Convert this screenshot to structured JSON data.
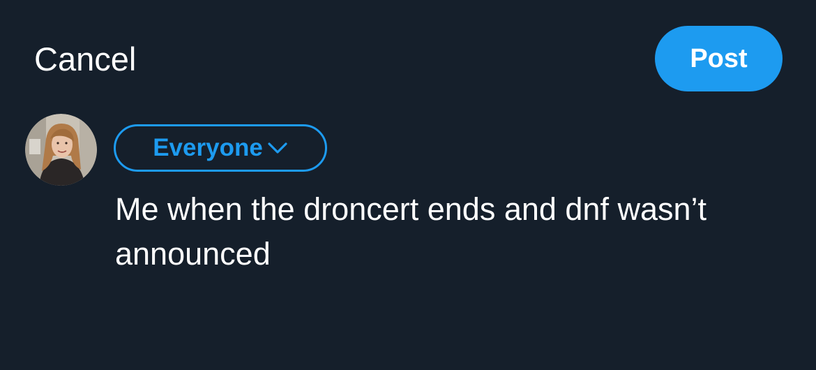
{
  "header": {
    "cancel_label": "Cancel",
    "post_label": "Post"
  },
  "composer": {
    "audience_label": "Everyone",
    "text": "Me when the droncert ends and dnf wasn’t announced"
  },
  "icons": {
    "audience_chevron": "chevron-down-icon",
    "avatar": "user-avatar"
  },
  "colors": {
    "background": "#151f2b",
    "accent": "#1d9bf0",
    "text": "#ffffff"
  }
}
